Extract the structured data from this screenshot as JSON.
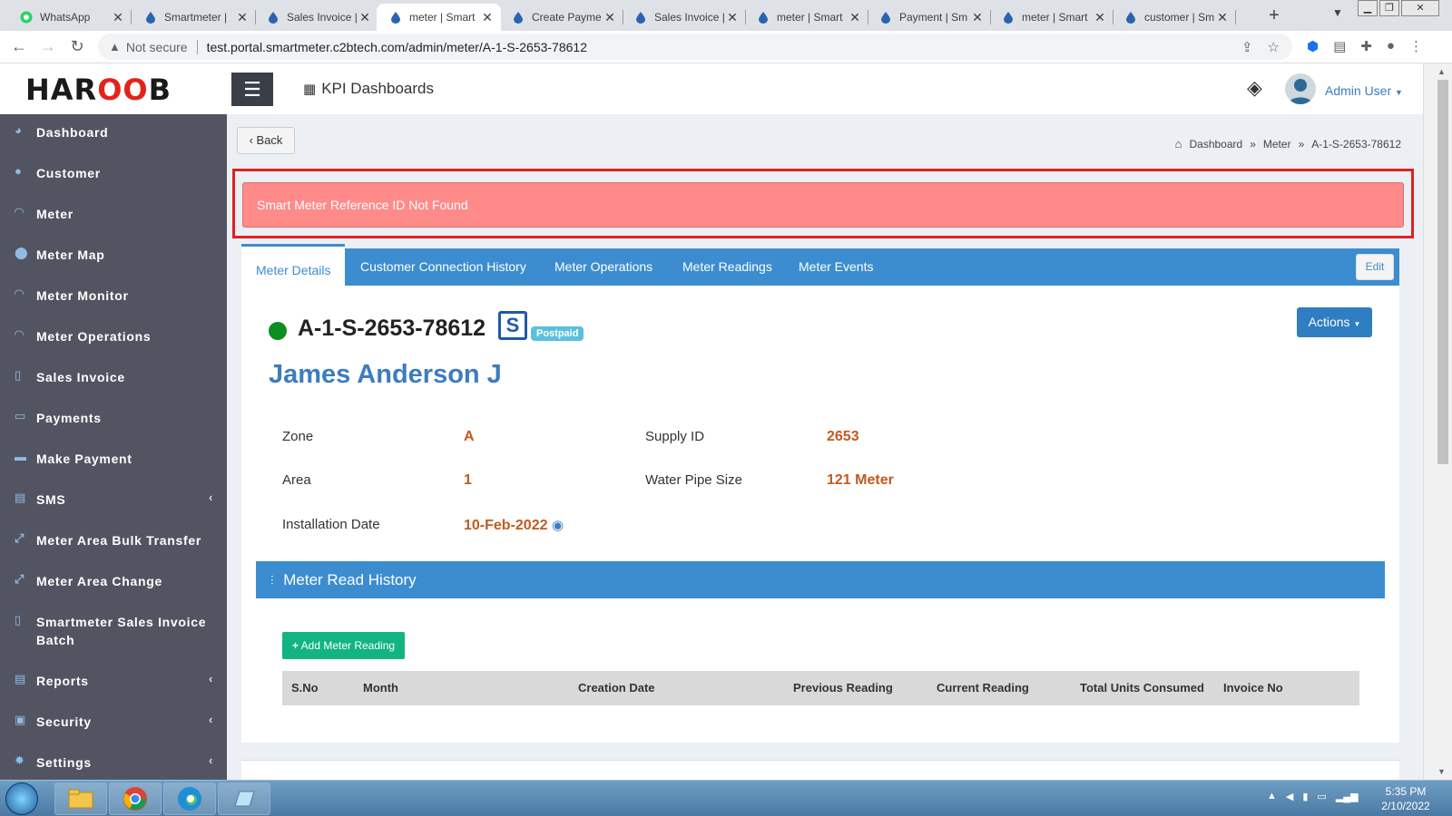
{
  "browser": {
    "tabs": [
      {
        "title": "WhatsApp",
        "icon": "whatsapp-icon",
        "active": false
      },
      {
        "title": "Smartmeter |",
        "icon": "water-drop-icon",
        "active": false
      },
      {
        "title": "Sales Invoice |",
        "icon": "water-drop-icon",
        "active": false
      },
      {
        "title": "meter | Smart",
        "icon": "water-drop-icon",
        "active": true
      },
      {
        "title": "Create Payme",
        "icon": "water-drop-icon",
        "active": false
      },
      {
        "title": "Sales Invoice |",
        "icon": "water-drop-icon",
        "active": false
      },
      {
        "title": "meter | Smart",
        "icon": "water-drop-icon",
        "active": false
      },
      {
        "title": "Payment | Sm",
        "icon": "water-drop-icon",
        "active": false
      },
      {
        "title": "meter | Smart",
        "icon": "water-drop-icon",
        "active": false
      },
      {
        "title": "customer | Sm",
        "icon": "water-drop-icon",
        "active": false
      }
    ],
    "not_secure": "Not secure",
    "url": "test.portal.smartmeter.c2btech.com/admin/meter/A-1-S-2653-78612"
  },
  "header": {
    "logo_left": "HAR",
    "logo_mid": "OO",
    "logo_right": "B",
    "kpi_label": "KPI Dashboards",
    "user_name": "Admin User"
  },
  "sidebar": {
    "items": [
      {
        "label": "Dashboard",
        "icon": "pie-chart-icon",
        "arrow": false
      },
      {
        "label": "Customer",
        "icon": "user-icon",
        "arrow": false
      },
      {
        "label": "Meter",
        "icon": "gauge-icon",
        "arrow": false
      },
      {
        "label": "Meter Map",
        "icon": "map-pin-icon",
        "arrow": false
      },
      {
        "label": "Meter Monitor",
        "icon": "gauge-icon",
        "arrow": false
      },
      {
        "label": "Meter Operations",
        "icon": "gauge-icon",
        "arrow": false
      },
      {
        "label": "Sales Invoice",
        "icon": "file-icon",
        "arrow": false
      },
      {
        "label": "Payments",
        "icon": "money-icon",
        "arrow": false
      },
      {
        "label": "Make Payment",
        "icon": "credit-card-icon",
        "arrow": false
      },
      {
        "label": "SMS",
        "icon": "sms-icon",
        "arrow": true
      },
      {
        "label": "Meter Area Bulk Transfer",
        "icon": "transfer-icon",
        "arrow": false
      },
      {
        "label": "Meter Area Change",
        "icon": "transfer-icon",
        "arrow": false
      },
      {
        "label": "Smartmeter Sales Invoice Batch",
        "icon": "file-icon",
        "arrow": false
      },
      {
        "label": "Reports",
        "icon": "report-icon",
        "arrow": true
      },
      {
        "label": "Security",
        "icon": "lock-icon",
        "arrow": true
      },
      {
        "label": "Settings",
        "icon": "gear-icon",
        "arrow": true
      }
    ]
  },
  "content": {
    "back_label": "Back",
    "breadcrumb": [
      "Dashboard",
      "Meter",
      "A-1-S-2653-78612"
    ],
    "alert_message": "Smart Meter Reference ID Not Found",
    "tabs": [
      "Meter Details",
      "Customer Connection History",
      "Meter Operations",
      "Meter Readings",
      "Meter Events"
    ],
    "edit_label": "Edit",
    "meter_id": "A-1-S-2653-78612",
    "meter_type_badge": "Postpaid",
    "actions_label": "Actions",
    "customer_name": "James Anderson J",
    "fields": {
      "zone_label": "Zone",
      "zone_value": "A",
      "supply_label": "Supply ID",
      "supply_value": "2653",
      "area_label": "Area",
      "area_value": "1",
      "pipe_label": "Water Pipe Size",
      "pipe_value": "121 Meter",
      "install_label": "Installation Date",
      "install_value": "10-Feb-2022"
    },
    "history_title": "Meter Read History",
    "add_reading_label": "Add Meter Reading",
    "table_headers": [
      "S.No",
      "Month",
      "Creation Date",
      "Previous Reading",
      "Current Reading",
      "Total Units Consumed",
      "Invoice No"
    ]
  },
  "taskbar": {
    "time": "5:35 PM",
    "date": "2/10/2022"
  },
  "colors": {
    "sidebar_bg": "#525561",
    "primary_blue": "#3c8dd0",
    "alert_bg": "#ff8a8a",
    "value_orange": "#c05b1f",
    "add_green": "#12b482"
  }
}
